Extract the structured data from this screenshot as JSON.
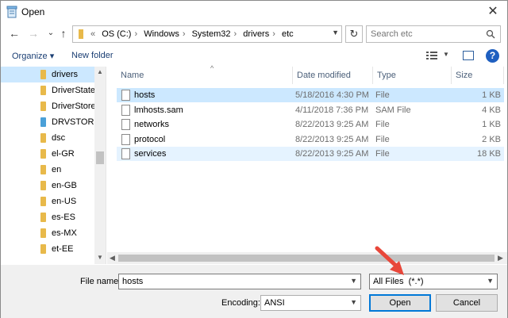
{
  "window": {
    "title": "Open",
    "close_glyph": "✕"
  },
  "nav": {
    "back_glyph": "←",
    "forward_glyph": "→",
    "recent_glyph": "⌄",
    "up_glyph": "↑",
    "crumb_prefix": "«",
    "crumbs": [
      "OS (C:)",
      "Windows",
      "System32",
      "drivers",
      "etc"
    ],
    "crumb_sep": "›",
    "refresh_glyph": "↻",
    "search_placeholder": "Search etc"
  },
  "toolbar": {
    "organize_label": "Organize ▾",
    "new_folder_label": "New folder",
    "help_label": "?"
  },
  "nav_pane": {
    "items": [
      {
        "label": "drivers",
        "selected": true,
        "special": false
      },
      {
        "label": "DriverState",
        "selected": false,
        "special": false
      },
      {
        "label": "DriverStore",
        "selected": false,
        "special": false
      },
      {
        "label": "DRVSTORE",
        "selected": false,
        "special": true
      },
      {
        "label": "dsc",
        "selected": false,
        "special": false
      },
      {
        "label": "el-GR",
        "selected": false,
        "special": false
      },
      {
        "label": "en",
        "selected": false,
        "special": false
      },
      {
        "label": "en-GB",
        "selected": false,
        "special": false
      },
      {
        "label": "en-US",
        "selected": false,
        "special": false
      },
      {
        "label": "es-ES",
        "selected": false,
        "special": false
      },
      {
        "label": "es-MX",
        "selected": false,
        "special": false
      },
      {
        "label": "et-EE",
        "selected": false,
        "special": false
      }
    ]
  },
  "file_list": {
    "columns": {
      "name": "Name",
      "date": "Date modified",
      "type": "Type",
      "size": "Size"
    },
    "rows": [
      {
        "name": "hosts",
        "date": "5/18/2016 4:30 PM",
        "type": "File",
        "size": "1 KB",
        "state": "selected"
      },
      {
        "name": "lmhosts.sam",
        "date": "4/11/2018 7:36 PM",
        "type": "SAM File",
        "size": "4 KB",
        "state": ""
      },
      {
        "name": "networks",
        "date": "8/22/2013 9:25 AM",
        "type": "File",
        "size": "1 KB",
        "state": ""
      },
      {
        "name": "protocol",
        "date": "8/22/2013 9:25 AM",
        "type": "File",
        "size": "2 KB",
        "state": ""
      },
      {
        "name": "services",
        "date": "8/22/2013 9:25 AM",
        "type": "File",
        "size": "18 KB",
        "state": "hover"
      }
    ]
  },
  "bottom": {
    "file_name_label": "File name:",
    "file_name_value": "hosts",
    "file_type_value": "All Files  (*.*)",
    "encoding_label": "Encoding:",
    "encoding_value": "ANSI",
    "open_label": "Open",
    "cancel_label": "Cancel"
  },
  "colors": {
    "selection": "#cce8ff",
    "accent": "#0078d7",
    "annotation_arrow": "#e8473a",
    "folder": "#e8b94a"
  }
}
